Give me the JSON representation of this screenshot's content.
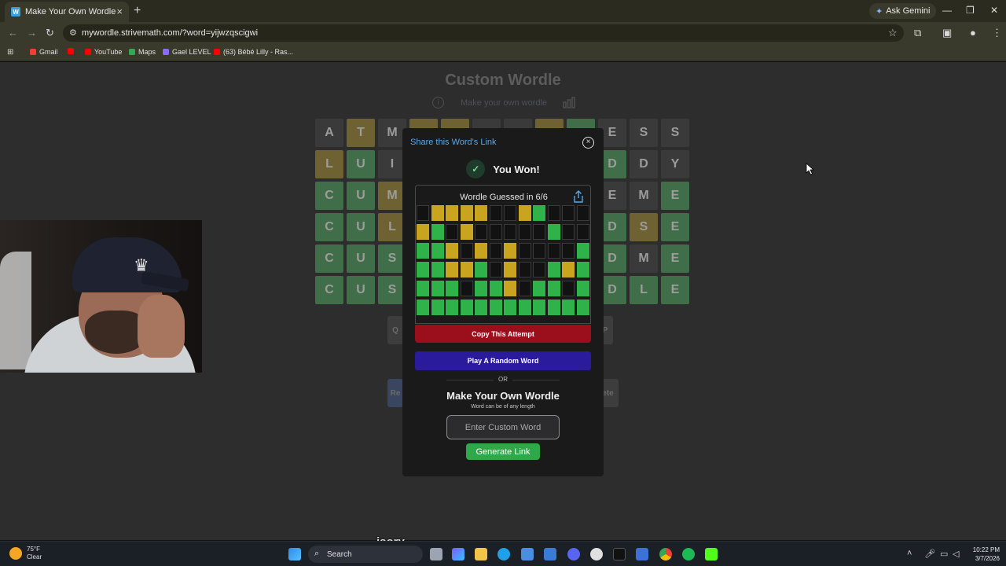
{
  "browser": {
    "tab_title": "Make Your Own Wordle",
    "tab_favicon": "W",
    "ask_gemini": "Ask Gemini",
    "url": "mywordle.strivemath.com/?word=yijwzqscigwi",
    "bookmarks": [
      {
        "label": "Gmail",
        "color": "#ea4335"
      },
      {
        "label": "",
        "color": "#ff0000"
      },
      {
        "label": "YouTube",
        "color": "#ff0000"
      },
      {
        "label": "Maps",
        "color": "#34a853"
      },
      {
        "label": "Gael LEVEL",
        "color": "#8a6cf0"
      },
      {
        "label": "(63) Bébé Lilly - Ras...",
        "color": "#ff0000"
      }
    ]
  },
  "page": {
    "title": "Custom Wordle",
    "subtitle": "Make your own wordle"
  },
  "background_board": [
    [
      "A",
      "T",
      "M",
      "",
      "",
      "",
      "",
      "",
      "",
      "E",
      "S",
      "S"
    ],
    [
      "L",
      "U",
      "I",
      "",
      "",
      "",
      "",
      "",
      "",
      "D",
      "D",
      "Y"
    ],
    [
      "C",
      "U",
      "M",
      "",
      "",
      "",
      "",
      "",
      "",
      "E",
      "M",
      "E"
    ],
    [
      "C",
      "U",
      "L",
      "",
      "",
      "",
      "",
      "",
      "",
      "D",
      "S",
      "E"
    ],
    [
      "C",
      "U",
      "S",
      "",
      "",
      "",
      "",
      "",
      "",
      "D",
      "M",
      "E"
    ],
    [
      "C",
      "U",
      "S",
      "",
      "",
      "",
      "",
      "",
      "",
      "D",
      "L",
      "E"
    ]
  ],
  "background_board_colors": [
    [
      "x",
      "y",
      "x",
      "y",
      "y",
      "x",
      "x",
      "y",
      "g",
      "x",
      "x",
      "x"
    ],
    [
      "y",
      "g",
      "x",
      "x",
      "x",
      "x",
      "x",
      "x",
      "x",
      "g",
      "x",
      "x"
    ],
    [
      "g",
      "g",
      "y",
      "x",
      "x",
      "x",
      "x",
      "x",
      "x",
      "x",
      "x",
      "g"
    ],
    [
      "g",
      "g",
      "y",
      "x",
      "x",
      "x",
      "x",
      "x",
      "x",
      "g",
      "y",
      "g"
    ],
    [
      "g",
      "g",
      "g",
      "x",
      "x",
      "x",
      "x",
      "x",
      "x",
      "g",
      "x",
      "g"
    ],
    [
      "g",
      "g",
      "g",
      "x",
      "x",
      "x",
      "x",
      "x",
      "x",
      "g",
      "g",
      "g"
    ]
  ],
  "background_keys": {
    "q_left": "Q",
    "p_right": "P",
    "re_left": "Re",
    "ete_right": "ete"
  },
  "modal": {
    "header": "Share this Word's Link",
    "you_won": "You Won!",
    "result_title": "Wordle Guessed in 6/6",
    "grid": [
      [
        "x",
        "y",
        "y",
        "y",
        "y",
        "x",
        "x",
        "y",
        "g",
        "x",
        "x",
        "x"
      ],
      [
        "y",
        "g",
        "x",
        "y",
        "x",
        "x",
        "x",
        "x",
        "x",
        "g",
        "x",
        "x"
      ],
      [
        "g",
        "g",
        "y",
        "x",
        "y",
        "x",
        "y",
        "x",
        "x",
        "x",
        "x",
        "g"
      ],
      [
        "g",
        "g",
        "y",
        "y",
        "g",
        "x",
        "y",
        "x",
        "x",
        "g",
        "y",
        "g"
      ],
      [
        "g",
        "g",
        "g",
        "x",
        "g",
        "g",
        "y",
        "x",
        "g",
        "g",
        "x",
        "g"
      ],
      [
        "g",
        "g",
        "g",
        "g",
        "g",
        "g",
        "g",
        "g",
        "g",
        "g",
        "g",
        "g"
      ]
    ],
    "copy_button": "Copy This Attempt",
    "random_button": "Play A Random Word",
    "or_text": "OR",
    "make_title": "Make Your Own Wordle",
    "make_sub": "Word can be of any length",
    "input_placeholder": "Enter Custom Word",
    "generate_button": "Generate Link"
  },
  "caption": "isory",
  "taskbar": {
    "temp": "75°F",
    "condition": "Clear",
    "search": "Search",
    "time": "10:22 PM",
    "date": "3/7/2026"
  },
  "colors": {
    "yellow": "#c9a51f",
    "green": "#2fb24a",
    "copy_red": "#9b0f1d",
    "random_blue": "#2a1a9c"
  }
}
